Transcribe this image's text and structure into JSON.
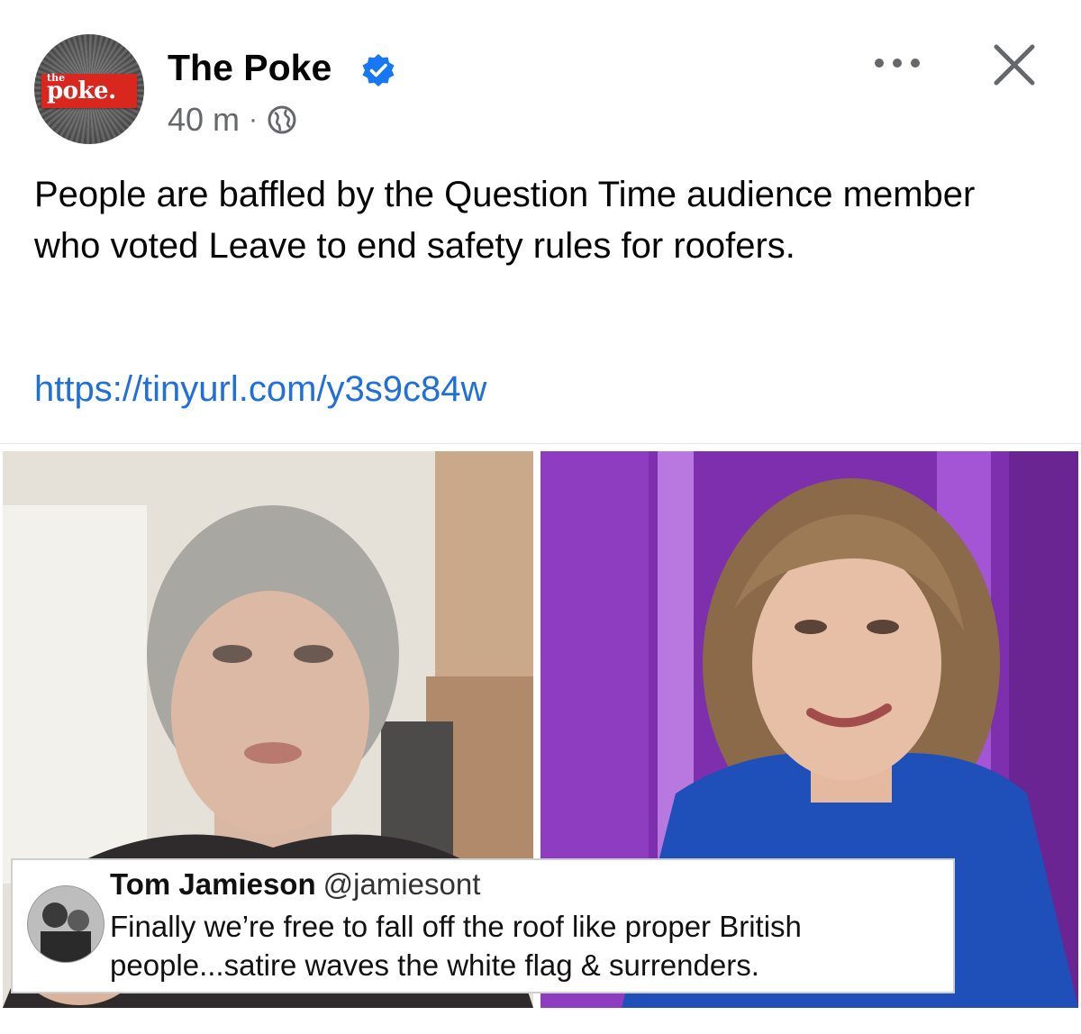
{
  "header": {
    "page_name": "The Poke",
    "time": "40 m",
    "separator": "·",
    "avatar_logo_small": "the",
    "avatar_logo_main": "poke.",
    "icons": {
      "verified": "verified-badge-icon",
      "audience": "globe-icon",
      "more": "more-dots-icon",
      "close": "close-icon"
    }
  },
  "post": {
    "text": "People are baffled by the Question Time audience member who voted Leave to end safety rules for roofers.",
    "link": "https://tinyurl.com/y3s9c84w"
  },
  "image": {
    "tweet": {
      "author_name": "Tom Jamieson",
      "author_handle": "@jamiesont",
      "text": "Finally we’re free to fall off the roof like proper British people...satire waves the white flag & surrenders."
    }
  },
  "colors": {
    "text_primary": "#050505",
    "text_secondary": "#65676b",
    "link": "#216fdb",
    "verified": "#1877f2",
    "logo_red": "#d9271f"
  }
}
